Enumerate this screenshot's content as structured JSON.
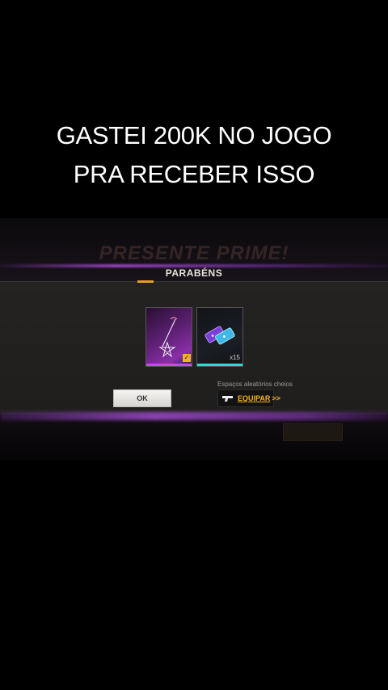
{
  "caption": {
    "line1": "GASTEI 200K NO JOGO",
    "line2": "PRA RECEBER ISSO"
  },
  "background": {
    "title": "PRESENTE PRIME!"
  },
  "modal": {
    "title": "PARABÉNS",
    "items": [
      {
        "name": "emote-gift",
        "rarity_color": "#c24de6",
        "equipped": true
      },
      {
        "name": "voucher-bundle",
        "rarity_color": "#2fd8d0",
        "quantity": "x15"
      }
    ],
    "slots_notice": "Espaços aleatórios cheios",
    "ok_label": "OK",
    "equip_label": "EQUIPAR",
    "equip_chevron": ">>"
  },
  "colors": {
    "accent_gold": "#f2b41c",
    "purple_glow": "#b450e6",
    "modal_bg": "#222020"
  }
}
